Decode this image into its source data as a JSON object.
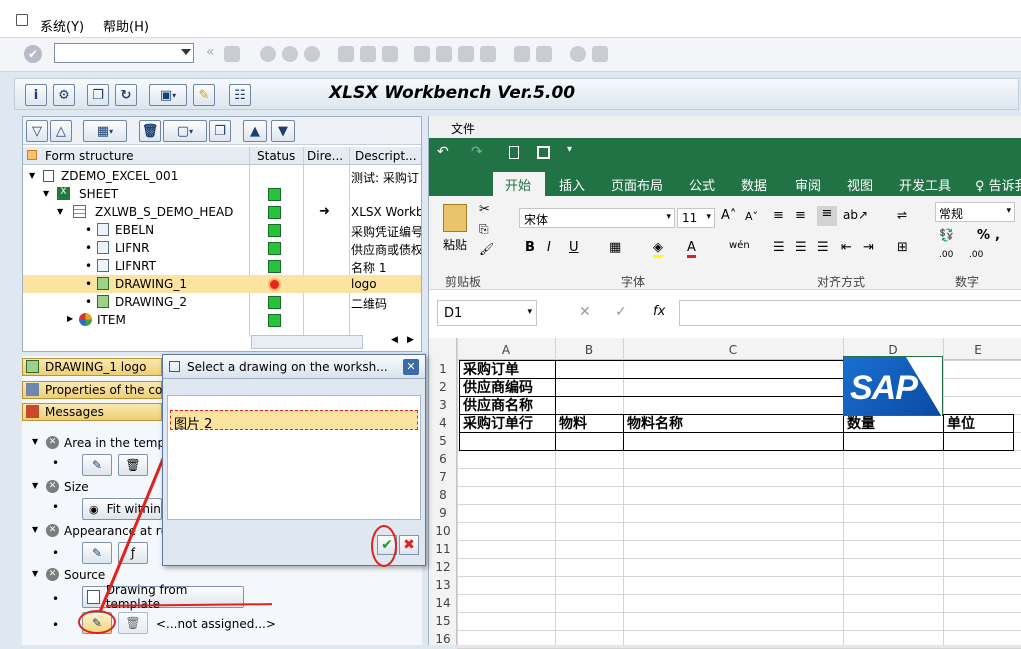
{
  "menu": {
    "system": "系统(Y)",
    "help": "帮助(H)"
  },
  "app_title": "XLSX Workbench Ver.5.00",
  "tree": {
    "columns": [
      "Form structure",
      "Status",
      "Dire...",
      "Descript..."
    ],
    "rows": [
      {
        "label": "ZDEMO_EXCEL_001",
        "desc": "测试: 采购订",
        "status": "none"
      },
      {
        "label": "SHEET",
        "desc": "",
        "status": "green"
      },
      {
        "label": "ZXLWB_S_DEMO_HEAD",
        "desc": "XLSX Workb",
        "status": "green",
        "arrow": "➜"
      },
      {
        "label": "EBELN",
        "desc": "采购凭证编号",
        "status": "green"
      },
      {
        "label": "LIFNR",
        "desc": "供应商或债权",
        "status": "green"
      },
      {
        "label": "LIFNRT",
        "desc": "名称 1",
        "status": "green"
      },
      {
        "label": "DRAWING_1",
        "desc": "logo",
        "status": "red"
      },
      {
        "label": "DRAWING_2",
        "desc": "二维码",
        "status": "green"
      },
      {
        "label": "ITEM",
        "desc": "",
        "status": "green"
      }
    ]
  },
  "lower": {
    "header": "DRAWING_1  logo",
    "properties_bar": "Properties of the con",
    "messages_bar": "Messages",
    "area_label": "Area in the templa",
    "size_label": "Size",
    "fit_label": "Fit within",
    "appearance_label": "Appearance at run",
    "source_label": "Source",
    "drawing_from_template": "Drawing from template",
    "not_assigned": "<...not assigned...>"
  },
  "dialog": {
    "title": "Select a drawing on the worksh...",
    "item": "图片 2"
  },
  "excel": {
    "file_tab": "文件",
    "tabs": [
      "开始",
      "插入",
      "页面布局",
      "公式",
      "数据",
      "审阅",
      "视图",
      "开发工具",
      "♀ 告诉我"
    ],
    "font_name": "宋体",
    "font_size": "11",
    "number_format": "常规",
    "paste_label": "粘贴",
    "groups": [
      "剪贴板",
      "字体",
      "对齐方式",
      "数字"
    ],
    "name_box": "D1",
    "fx": "fx",
    "columns": [
      "A",
      "B",
      "C",
      "D",
      "E"
    ],
    "rows": [
      "1",
      "2",
      "3",
      "4",
      "5",
      "6",
      "7",
      "8",
      "9",
      "10",
      "11",
      "12",
      "13",
      "14",
      "15",
      "16"
    ],
    "cells": {
      "a1": "采购订单",
      "a2": "供应商编码",
      "a3": "供应商名称",
      "a4": "采购订单行",
      "b4": "物料",
      "c4": "物料名称",
      "d4": "数量",
      "e4": "单位"
    },
    "logo_text": "SAP",
    "accent": "#217346"
  }
}
